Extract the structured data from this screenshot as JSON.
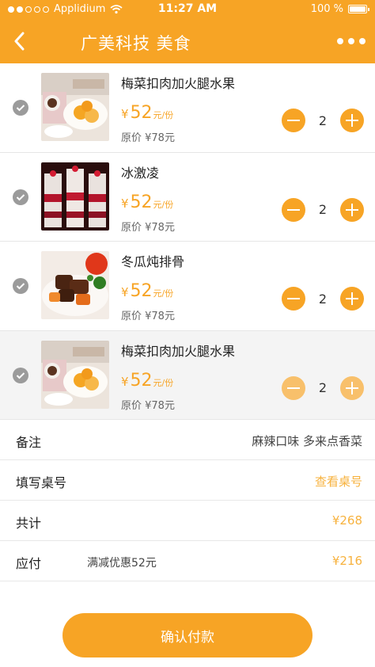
{
  "status_bar": {
    "carrier": "Applidium",
    "time": "11:27 AM",
    "battery": "100 %"
  },
  "nav": {
    "title": "广美科技 美食"
  },
  "items": [
    {
      "name": "梅菜扣肉加火腿水果",
      "currency": "¥",
      "price": "52",
      "unit": "元/份",
      "original": "原价 ¥78元",
      "quantity": "2",
      "image": "breakfast-plate"
    },
    {
      "name": "冰激凌",
      "currency": "¥",
      "price": "52",
      "unit": "元/份",
      "original": "原价 ¥78元",
      "quantity": "2",
      "image": "ice-cream-cups"
    },
    {
      "name": "冬瓜炖排骨",
      "currency": "¥",
      "price": "52",
      "unit": "元/份",
      "original": "原价 ¥78元",
      "quantity": "2",
      "image": "braised-ribs"
    },
    {
      "name": "梅菜扣肉加火腿水果",
      "currency": "¥",
      "price": "52",
      "unit": "元/份",
      "original": "原价 ¥78元",
      "quantity": "2",
      "image": "breakfast-plate"
    }
  ],
  "summary": {
    "remark_label": "备注",
    "remark_value": "麻辣口味 多来点香菜",
    "table_label": "填写桌号",
    "table_value": "查看桌号",
    "total_label": "共计",
    "total_value": "¥268",
    "payable_label": "应付",
    "discount_text": "满减优惠52元",
    "payable_value": "¥216"
  },
  "actions": {
    "confirm_pay": "确认付款"
  },
  "colors": {
    "accent": "#f7a425",
    "accent_light": "#f8c06b",
    "check": "#9b9b9b"
  }
}
